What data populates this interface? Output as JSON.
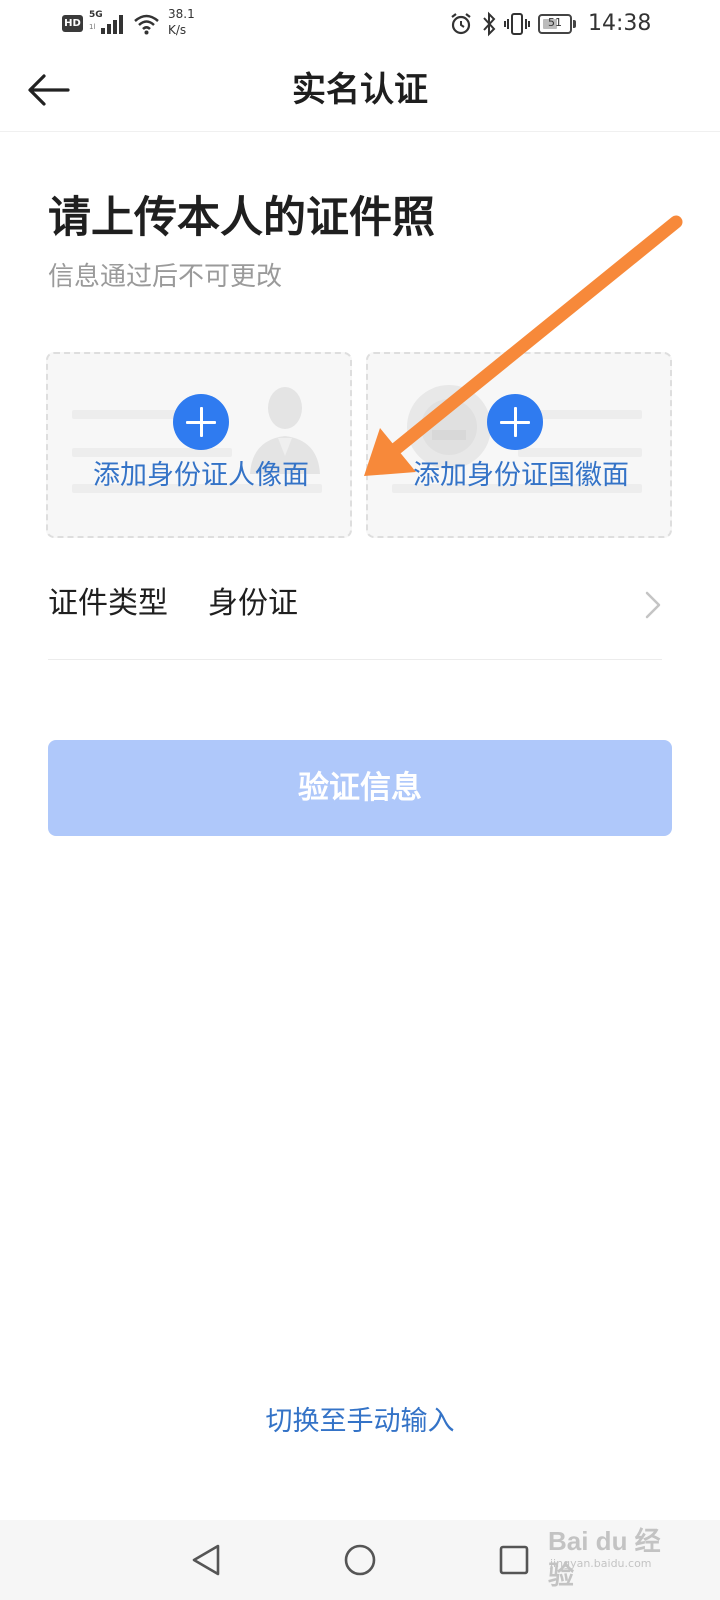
{
  "status_bar": {
    "hd": "HD",
    "network": "5G",
    "network_sub": "1l",
    "net_speed_value": "38.1",
    "net_speed_unit": "K/s",
    "battery": "51",
    "time": "14:38"
  },
  "header": {
    "title": "实名认证"
  },
  "main": {
    "heading": "请上传本人的证件照",
    "subheading": "信息通过后不可更改",
    "cards": [
      {
        "label": "添加身份证人像面"
      },
      {
        "label": "添加身份证国徽面"
      }
    ],
    "doc_type": {
      "label": "证件类型",
      "value": "身份证"
    },
    "verify_button": "验证信息",
    "manual_link": "切换至手动输入"
  },
  "watermark": {
    "main": "Bai du 经验",
    "sub": "jingyan.baidu.com"
  },
  "colors": {
    "accent_blue": "#2f7bf0",
    "link_blue": "#3473c7",
    "button_disabled": "#afc8fa",
    "annotation_arrow": "#f7893a"
  },
  "icons": [
    "back-arrow-icon",
    "plus-icon",
    "chevron-right-icon",
    "nav-back-icon",
    "nav-home-icon",
    "nav-recents-icon",
    "alarm-icon",
    "bluetooth-icon",
    "vibrate-icon",
    "wifi-icon",
    "signal-icon"
  ]
}
